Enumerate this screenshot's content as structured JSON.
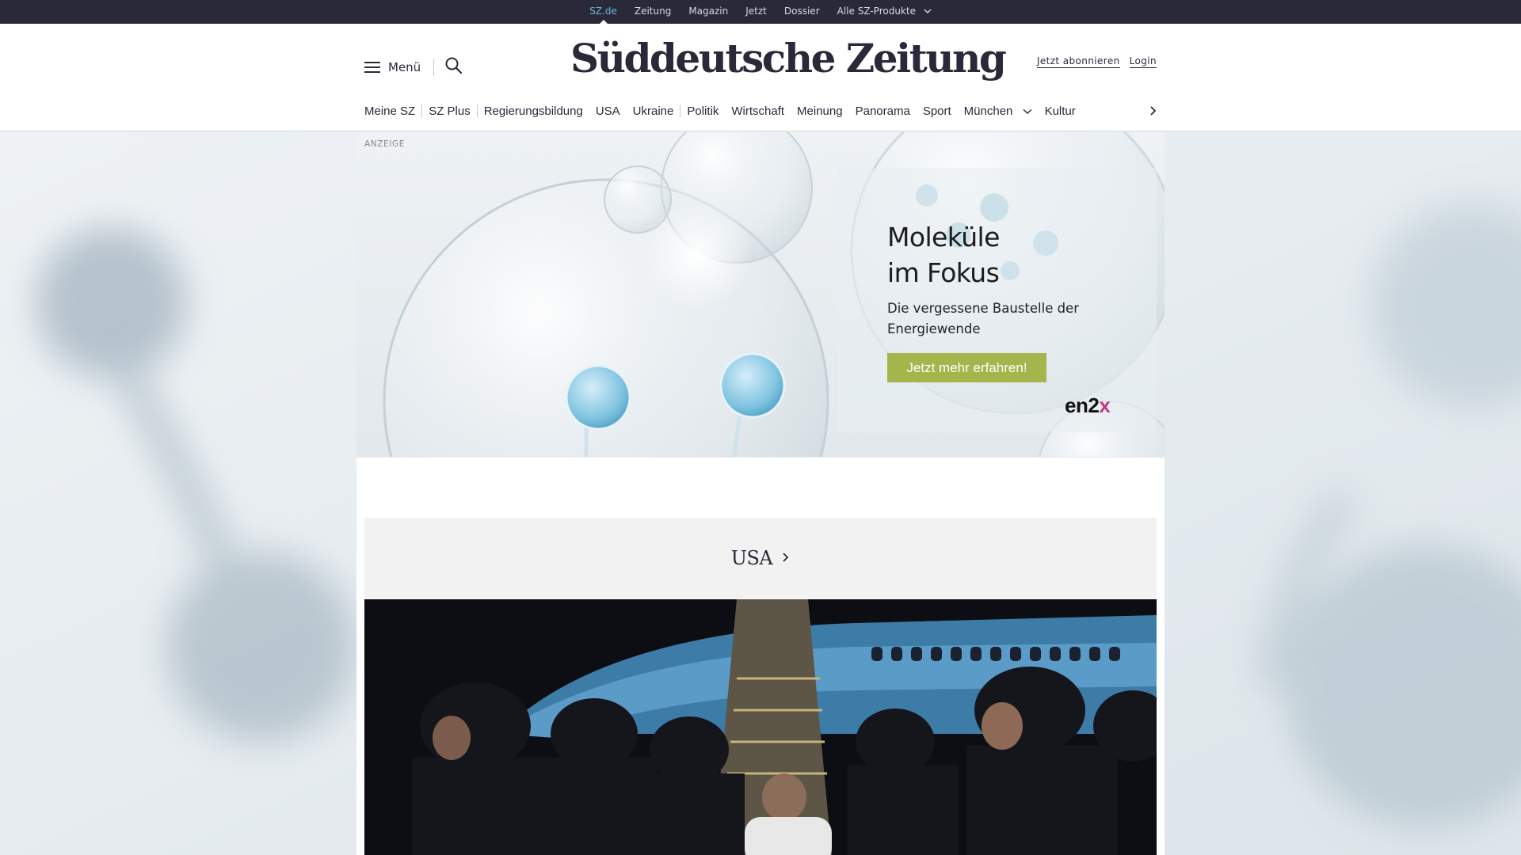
{
  "topbar": {
    "links": [
      "SZ.de",
      "Zeitung",
      "Magazin",
      "Jetzt",
      "Dossier",
      "Alle SZ-Produkte"
    ],
    "active": "SZ.de"
  },
  "header": {
    "menu_label": "Menü",
    "logo": "Süddeutsche Zeitung",
    "subscribe": "Jetzt abonnieren",
    "login": "Login"
  },
  "nav": {
    "items": [
      "Meine SZ",
      "SZ Plus",
      "Regierungsbildung",
      "USA",
      "Ukraine",
      "Politik",
      "Wirtschaft",
      "Meinung",
      "Panorama",
      "Sport",
      "München",
      "Kultur"
    ]
  },
  "ad": {
    "label": "ANZEIGE",
    "title": "Moleküle\nim Fokus",
    "subtitle": "Die vergessene Baustelle der Energiewende",
    "cta": "Jetzt mehr erfahren!",
    "brand_main": "en2",
    "brand_accent": "x"
  },
  "section": {
    "title": "USA"
  },
  "colors": {
    "topbar_bg": "#29293a",
    "active_link": "#71b8d6",
    "cta_green": "#a5b54b",
    "text": "#29293a"
  }
}
